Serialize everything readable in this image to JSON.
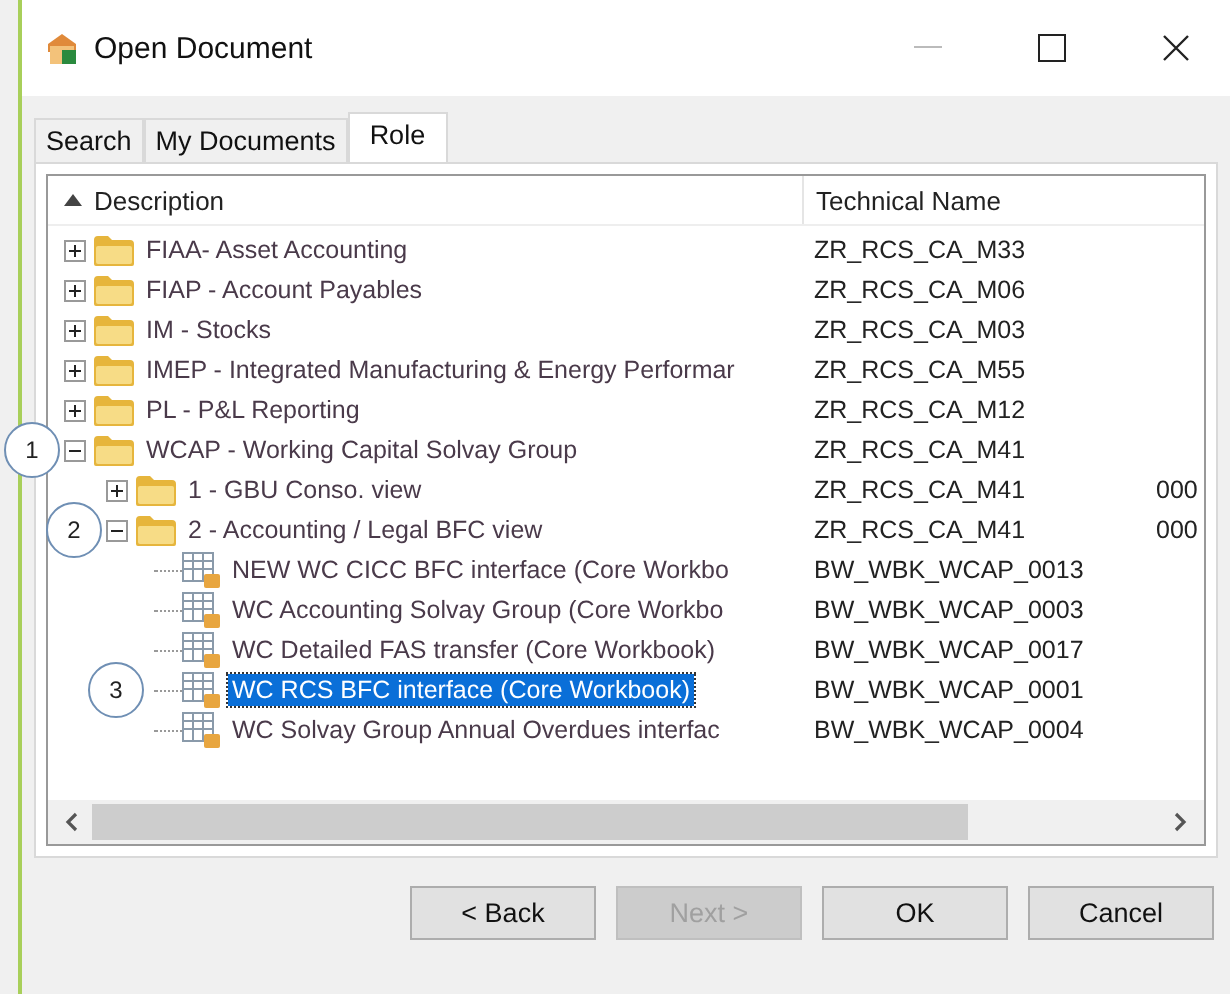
{
  "window": {
    "title": "Open Document"
  },
  "tabs": [
    {
      "label": "Search",
      "selected": false
    },
    {
      "label": "My Documents",
      "selected": false
    },
    {
      "label": "Role",
      "selected": true
    }
  ],
  "tree": {
    "columns": [
      "Description",
      "Technical Name"
    ],
    "rows": [
      {
        "kind": "folder",
        "label": "FIAA- Asset Accounting",
        "technical_name": "ZR_RCS_CA_M33",
        "expanded": false,
        "selected": false
      },
      {
        "kind": "folder",
        "label": "FIAP - Account Payables",
        "technical_name": "ZR_RCS_CA_M06",
        "expanded": false,
        "selected": false
      },
      {
        "kind": "folder",
        "label": "IM - Stocks",
        "technical_name": "ZR_RCS_CA_M03",
        "expanded": false,
        "selected": false
      },
      {
        "kind": "folder",
        "label": "IMEP - Integrated Manufacturing & Energy Performar",
        "technical_name": "ZR_RCS_CA_M55",
        "expanded": false,
        "selected": false
      },
      {
        "kind": "folder",
        "label": "PL - P&L Reporting",
        "technical_name": "ZR_RCS_CA_M12",
        "expanded": false,
        "selected": false
      },
      {
        "kind": "folder",
        "label": "WCAP - Working Capital Solvay Group",
        "technical_name": "ZR_RCS_CA_M41",
        "expanded": true,
        "selected": false,
        "callout": "1",
        "children": [
          {
            "kind": "folder",
            "label": "1 - GBU Conso. view",
            "technical_name": "ZR_RCS_CA_M41",
            "column_3": "000",
            "expanded": false,
            "selected": false
          },
          {
            "kind": "folder",
            "label": "2 - Accounting / Legal BFC view",
            "technical_name": "ZR_RCS_CA_M41",
            "column_3": "000",
            "expanded": true,
            "selected": false,
            "callout": "2",
            "children": [
              {
                "kind": "workbook",
                "label": "NEW WC CICC BFC interface (Core Workbo",
                "technical_name": "BW_WBK_WCAP_0013",
                "selected": false
              },
              {
                "kind": "workbook",
                "label": "WC Accounting Solvay Group (Core Workbo",
                "technical_name": "BW_WBK_WCAP_0003",
                "selected": false
              },
              {
                "kind": "workbook",
                "label": "WC Detailed FAS transfer (Core Workbook)",
                "technical_name": "BW_WBK_WCAP_0017",
                "selected": false
              },
              {
                "kind": "workbook",
                "label": "WC RCS BFC interface (Core Workbook)",
                "technical_name": "BW_WBK_WCAP_0001",
                "selected": true,
                "callout": "3"
              },
              {
                "kind": "workbook",
                "label": "WC Solvay Group Annual Overdues interfac",
                "technical_name": "BW_WBK_WCAP_0004",
                "selected": false
              }
            ]
          }
        ]
      }
    ]
  },
  "buttons": [
    {
      "label": "< Back",
      "disabled": false
    },
    {
      "label": "Next >",
      "disabled": true
    },
    {
      "label": "OK",
      "disabled": false
    },
    {
      "label": "Cancel",
      "disabled": false
    }
  ]
}
